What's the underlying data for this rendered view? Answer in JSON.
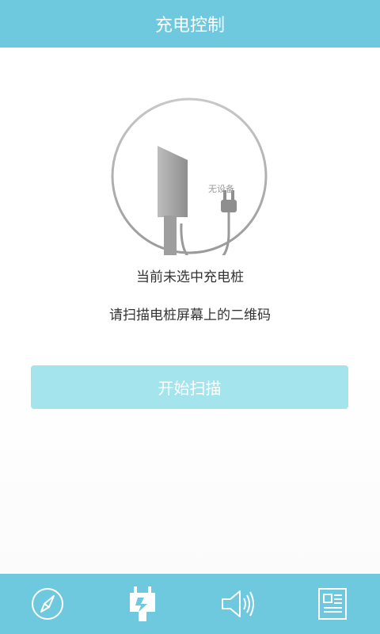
{
  "header": {
    "title": "充电控制"
  },
  "device": {
    "badge": "无设备",
    "icon": "charging-pile-unplugged-icon"
  },
  "status": {
    "line1": "当前未选中充电桩",
    "line2": "请扫描电桩屏幕上的二维码"
  },
  "action": {
    "scan_label": "开始扫描"
  },
  "tabbar": {
    "items": [
      {
        "icon": "compass-icon",
        "selected": false
      },
      {
        "icon": "charging-control-icon",
        "selected": true
      },
      {
        "icon": "speaker-icon",
        "selected": false
      },
      {
        "icon": "news-icon",
        "selected": false
      }
    ]
  },
  "colors": {
    "header_bg": "#6ec9de",
    "button_bg": "#a3e4ed",
    "text": "#333333"
  }
}
